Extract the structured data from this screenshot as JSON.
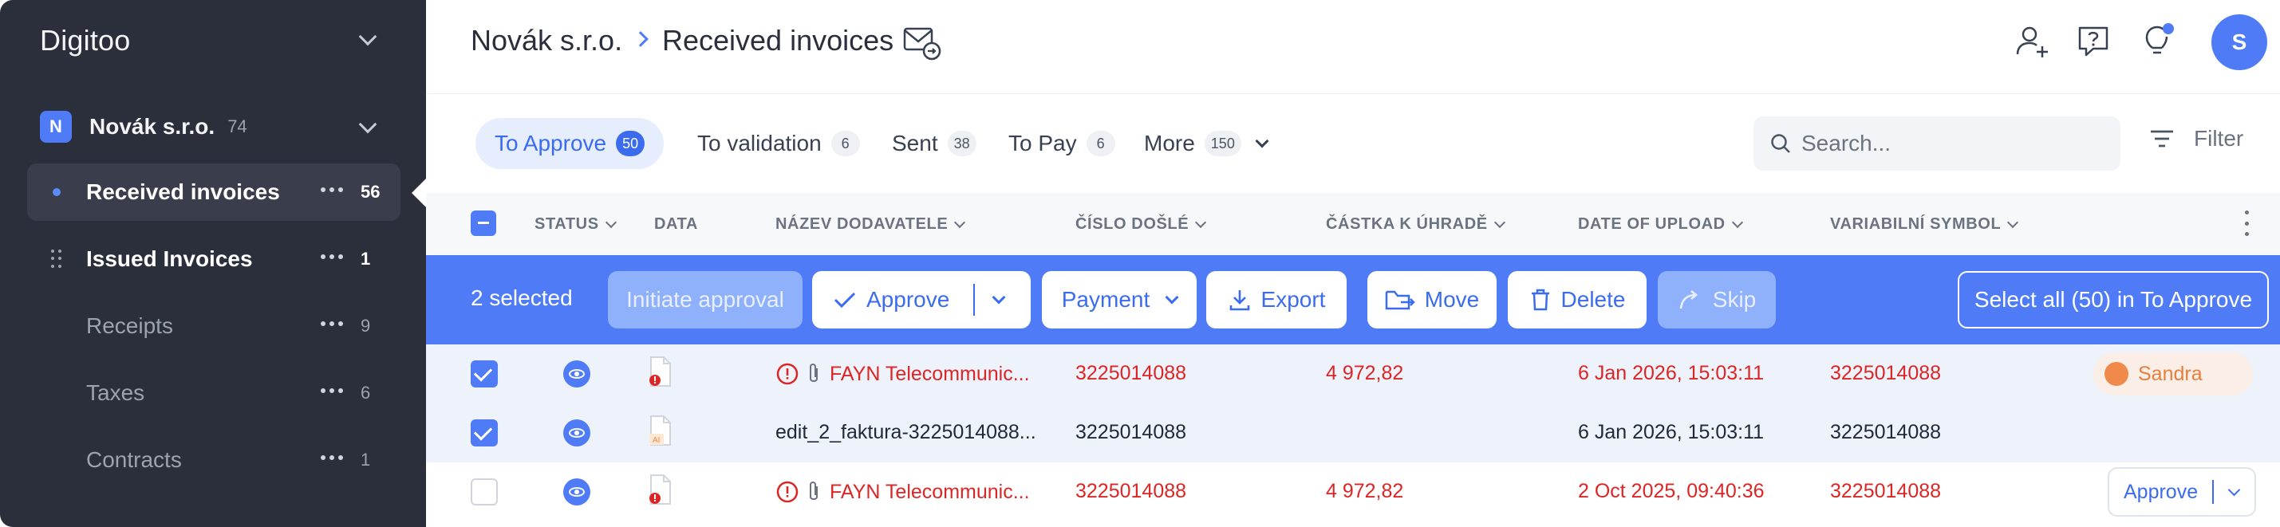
{
  "app": {
    "name": "Digitoo"
  },
  "sidebar": {
    "company": {
      "initial": "N",
      "name": "Novák s.r.o.",
      "count": "74"
    },
    "items": [
      {
        "label": "Received invoices",
        "count": "56",
        "active": true
      },
      {
        "label": "Issued Invoices",
        "count": "1"
      },
      {
        "label": "Receipts",
        "count": "9"
      },
      {
        "label": "Taxes",
        "count": "6"
      },
      {
        "label": "Contracts",
        "count": "1"
      }
    ]
  },
  "header": {
    "breadcrumb": [
      "Novák s.r.o.",
      "Received invoices"
    ],
    "avatar_initial": "S",
    "icons": [
      "email-forward-icon",
      "add-user-icon",
      "help-icon",
      "lightbulb-icon"
    ],
    "notification_dot_color": "#4f7cf6"
  },
  "tabs": [
    {
      "label": "To Approve",
      "count": "50",
      "active": true
    },
    {
      "label": "To validation",
      "count": "6"
    },
    {
      "label": "Sent",
      "count": "38"
    },
    {
      "label": "To Pay",
      "count": "6"
    },
    {
      "label": "More",
      "count": "150"
    }
  ],
  "search": {
    "placeholder": "Search..."
  },
  "filter": {
    "label": "Filter"
  },
  "table": {
    "columns": [
      "STATUS",
      "DATA",
      "NÁZEV DODAVATELE",
      "ČÍSLO DOŠLÉ",
      "ČÁSTKA K ÚHRADĚ",
      "DATE OF UPLOAD",
      "VARIABILNÍ SYMBOL"
    ],
    "rows": [
      {
        "selected": true,
        "has_error": true,
        "has_attachment": true,
        "supplier": "FAYN Telecommunic...",
        "number": "3225014088",
        "amount": "4 972,82",
        "uploaded": "6 Jan 2026, 15:03:11",
        "vs": "3225014088",
        "assignee": "Sandra"
      },
      {
        "selected": true,
        "has_error": false,
        "has_attachment": false,
        "supplier": "edit_2_faktura-3225014088...",
        "number": "3225014088",
        "amount": "",
        "uploaded": "6 Jan 2026, 15:03:11",
        "vs": "3225014088",
        "assignee": ""
      },
      {
        "selected": false,
        "has_error": true,
        "has_attachment": true,
        "supplier": "FAYN Telecommunic...",
        "number": "3225014088",
        "amount": "4 972,82",
        "uploaded": "2 Oct 2025, 09:40:36",
        "vs": "3225014088",
        "action": "Approve"
      }
    ]
  },
  "selection_bar": {
    "count_label": "2 selected",
    "initiate_approval": "Initiate approval",
    "approve": "Approve",
    "payment": "Payment",
    "export": "Export",
    "move": "Move",
    "delete": "Delete",
    "skip": "Skip",
    "select_all": "Select all (50) in To Approve"
  },
  "colors": {
    "accent": "#4f7cf6",
    "sidebar": "#2b2e3b",
    "error": "#dc2626",
    "assignee": "#e67e3c"
  }
}
